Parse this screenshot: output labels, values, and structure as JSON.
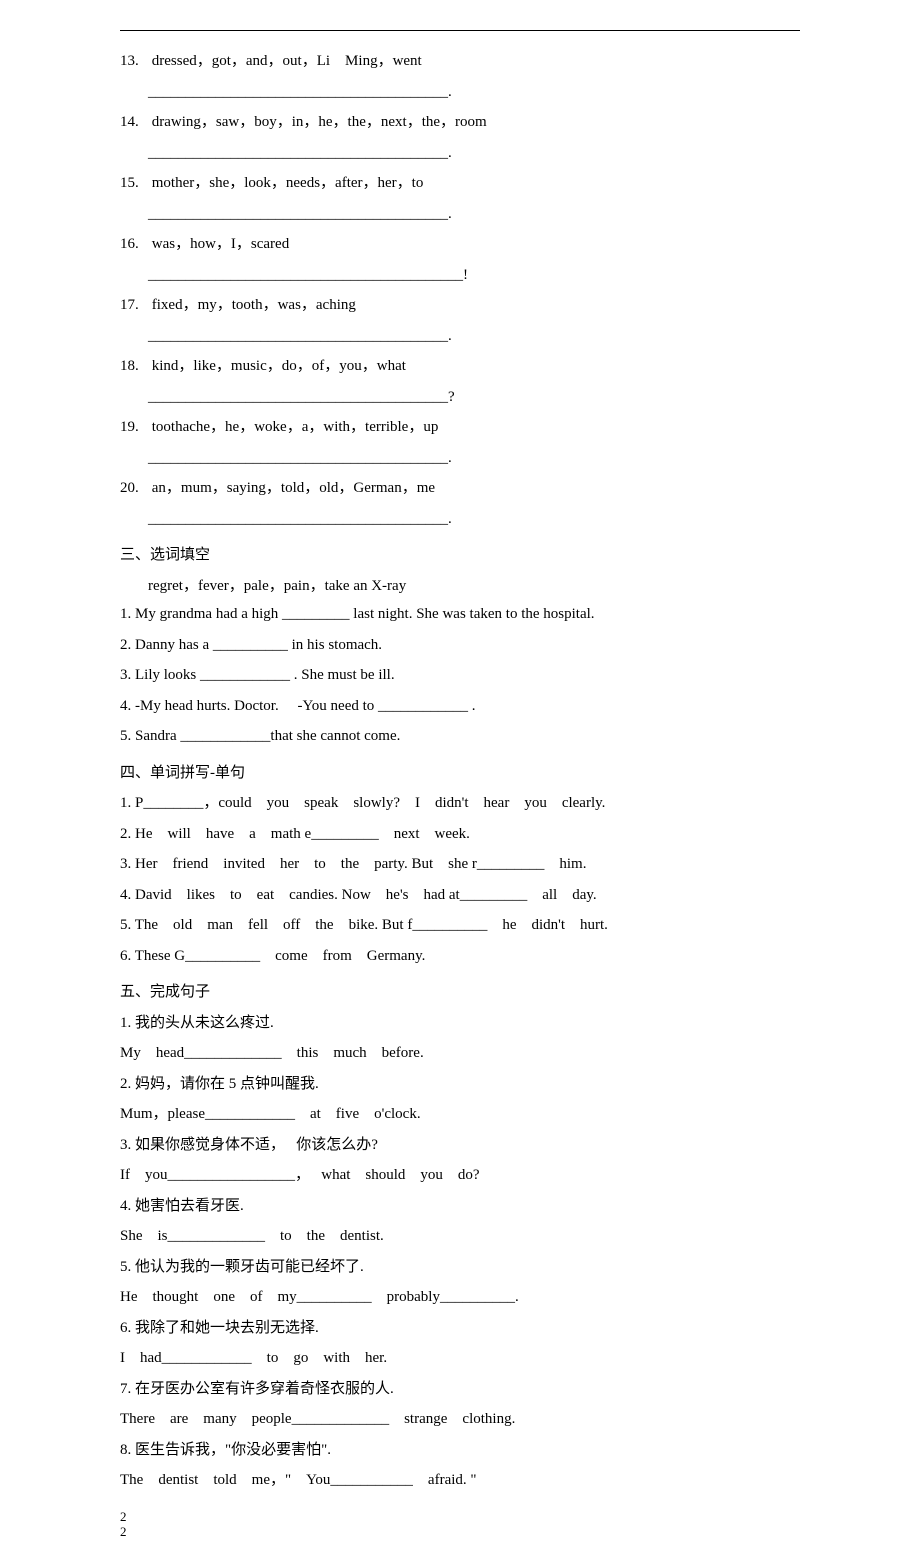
{
  "section2_items": [
    {
      "n": "13.",
      "words": "dressed，got，and，out，Li　Ming，went",
      "end": "."
    },
    {
      "n": "14.",
      "words": "drawing，saw，boy，in，he，the，next，the，room",
      "end": "."
    },
    {
      "n": "15.",
      "words": "mother，she，look，needs，after，her，to",
      "end": "."
    },
    {
      "n": "16.",
      "words": "was，how，I，scared",
      "end": "!"
    },
    {
      "n": "17.",
      "words": "fixed，my，tooth，was，aching",
      "end": "."
    },
    {
      "n": "18.",
      "words": "kind，like，music，do，of，you，what",
      "end": "?"
    },
    {
      "n": "19.",
      "words": "toothache，he，woke，a，with，terrible，up",
      "end": "."
    },
    {
      "n": "20.",
      "words": "an，mum，saying，told，old，German，me",
      "end": "."
    }
  ],
  "section3": {
    "title": "三、选词填空",
    "bank": "regret，fever，pale，pain，take an X-ray",
    "items": [
      "1. My grandma had a high _________ last night. She was taken to the hospital.",
      "2. Danny has a __________ in his stomach.",
      "3. Lily looks ____________ . She must be ill.",
      "4. -My head hurts. Doctor.　 -You need to ____________ .",
      "5. Sandra ____________that she cannot come."
    ]
  },
  "section4": {
    "title": "四、单词拼写-单句",
    "items": [
      "1. P________，could　you　speak　slowly?　I　didn't　hear　you　clearly.",
      "2. He　will　have　a　math e_________　next　week.",
      "3. Her　friend　invited　her　to　the　party. But　she r_________　him.",
      "4. David　likes　to　eat　candies. Now　he's　had at_________　all　day.",
      "5. The　old　man　fell　off　the　bike. But f__________　he　didn't　hurt.",
      "6. These G__________　come　from　Germany."
    ]
  },
  "section5": {
    "title": "五、完成句子",
    "items": [
      {
        "cn": "1. 我的头从未这么疼过.",
        "en": "My　head_____________　this　much　before."
      },
      {
        "cn": "2. 妈妈，请你在 5 点钟叫醒我.",
        "en": "Mum，please____________　at　five　o'clock."
      },
      {
        "cn": "3. 如果你感觉身体不适，　 你该怎么办?",
        "en": "If　you_________________，　 what　should　you　do?"
      },
      {
        "cn": "4. 她害怕去看牙医.",
        "en": "She　is_____________　to　the　dentist."
      },
      {
        "cn": "5. 他认为我的一颗牙齿可能已经坏了.",
        "en": "He　thought　one　of　my__________　probably__________."
      },
      {
        "cn": "6. 我除了和她一块去别无选择.",
        "en": "I　had____________　to　go　with　her."
      },
      {
        "cn": "7. 在牙医办公室有许多穿着奇怪衣服的人.",
        "en": "There　are　many　people_____________　strange　clothing."
      },
      {
        "cn": "8. 医生告诉我，\"你没必要害怕\".",
        "en": "The　dentist　told　me，\"　You___________　afraid. \""
      }
    ]
  },
  "footer": {
    "l1": "2",
    "l2": "2"
  },
  "ul40": "________________________________________",
  "ul42": "__________________________________________"
}
